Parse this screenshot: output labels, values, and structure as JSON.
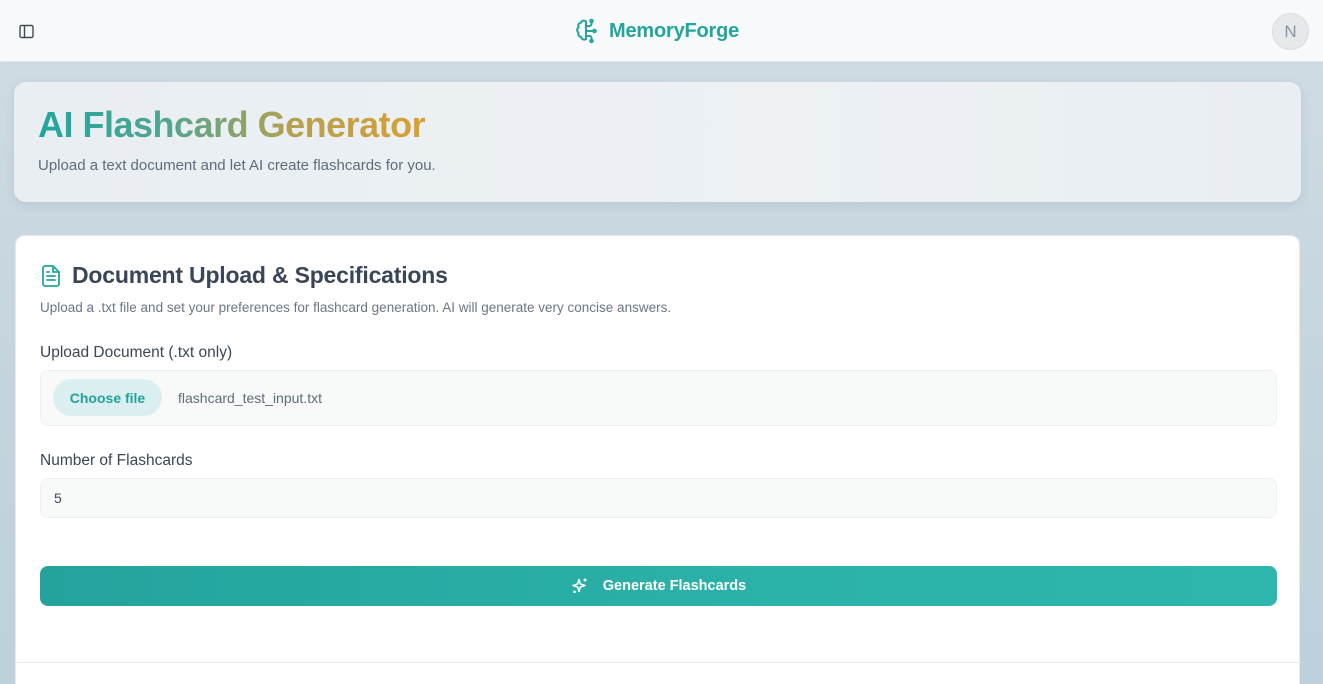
{
  "topbar": {
    "brand_name": "MemoryForge",
    "avatar_initial": "N"
  },
  "hero": {
    "title": "AI Flashcard Generator",
    "subtitle": "Upload a text document and let AI create flashcards for you."
  },
  "card": {
    "title": "Document Upload & Specifications",
    "description": "Upload a .txt file and set your preferences for flashcard generation. AI will generate very concise answers.",
    "upload_label": "Upload Document (.txt only)",
    "choose_file_label": "Choose file",
    "file_name": "flashcard_test_input.txt",
    "count_label": "Number of Flashcards",
    "count_value": "5",
    "generate_label": "Generate Flashcards"
  },
  "icons": {
    "sidebar_toggle": "sidebar-toggle-icon",
    "brand": "brain-icon",
    "document": "file-text-icon",
    "generate": "sparkles-icon"
  },
  "colors": {
    "accent": "#23a59e",
    "gradient_start": "#1fa6a0",
    "gradient_end": "#d9a033"
  }
}
